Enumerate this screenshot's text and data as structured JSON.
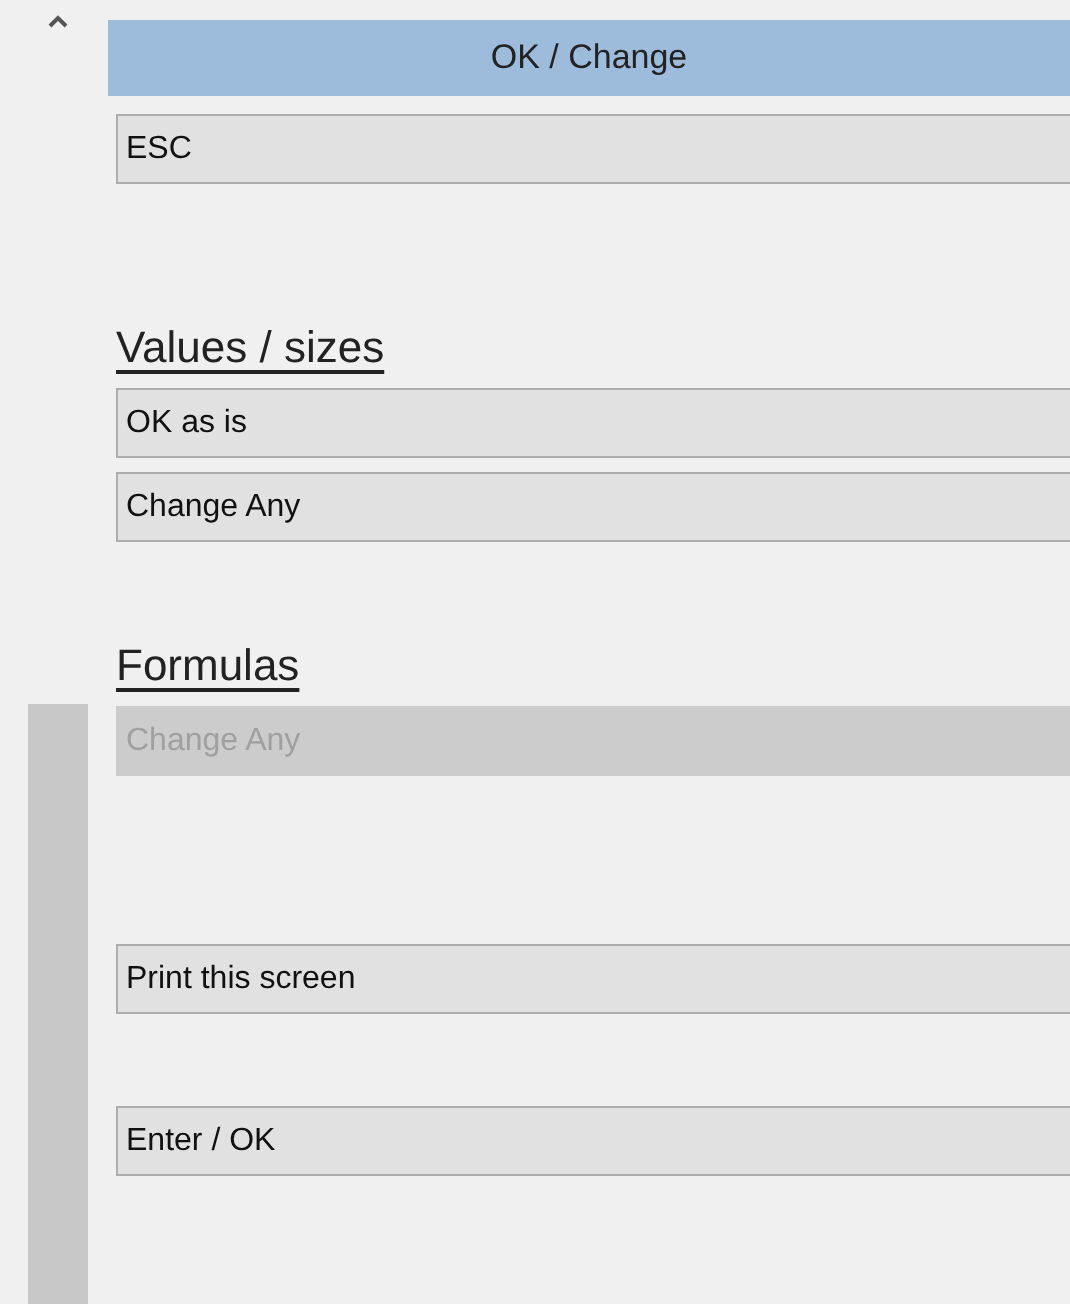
{
  "header": {
    "title": "OK / Change"
  },
  "sections": [
    {
      "buttons": [
        {
          "label": "ESC",
          "disabled": false
        }
      ]
    },
    {
      "heading": "Values / sizes",
      "buttons": [
        {
          "label": "OK as is",
          "disabled": false
        },
        {
          "label": "Change Any",
          "disabled": false
        }
      ]
    },
    {
      "heading": "Formulas",
      "buttons": [
        {
          "label": "Change Any",
          "disabled": true
        }
      ]
    },
    {
      "buttons": [
        {
          "label": "Print this screen",
          "disabled": false
        }
      ]
    },
    {
      "buttons": [
        {
          "label": "Enter / OK",
          "disabled": false
        }
      ]
    }
  ]
}
